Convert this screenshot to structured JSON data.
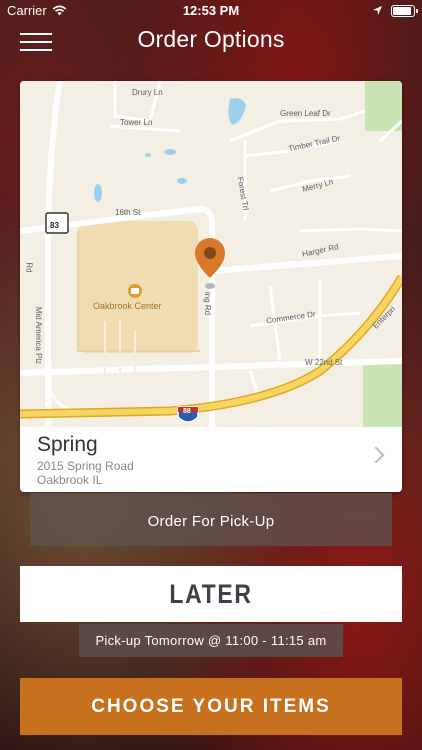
{
  "status_bar": {
    "carrier": "Carrier",
    "time": "12:53 PM",
    "battery_level": 1.0
  },
  "header": {
    "title": "Order Options"
  },
  "map": {
    "labels": {
      "drury": "Drury Ln",
      "tower": "Tower Ln",
      "green_leaf": "Green Leaf Dr",
      "timber_trail": "Timber Trail Dr",
      "forest": "Forest Trl",
      "merry": "Merry Ln",
      "sixteenth": "16th St",
      "route83": "83",
      "harger": "Harger Rd",
      "oakbrook_center": "Oakbrook Center",
      "spring_rd": "ing Rd",
      "mid_america": "Mid America Plz",
      "commerce": "Commerce Dr",
      "enterprise": "Enterpri",
      "w22nd": "W 22nd St",
      "rd_left": "Rd",
      "i88": "88"
    }
  },
  "location": {
    "name": "Spring",
    "address_line1": "2015 Spring Road",
    "address_line2": "Oakbrook IL"
  },
  "order_mode": {
    "label": "Order For Pick-Up"
  },
  "schedule": {
    "label": "LATER",
    "pickup_time": "Pick-up Tomorrow @ 11:00 - 11:15 am"
  },
  "actions": {
    "choose_items": "CHOOSE YOUR ITEMS"
  },
  "colors": {
    "accent": "#c7701d",
    "pin": "#d9772a",
    "highway": "#f4c542"
  }
}
